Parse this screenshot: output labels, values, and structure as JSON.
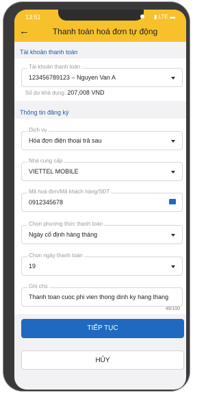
{
  "status": {
    "time": "13:51",
    "network": "LTE"
  },
  "header": {
    "title": "Thanh toán hoá đơn tự động",
    "back_icon": "back-arrow-icon"
  },
  "account": {
    "section_title": "Tài khoản thanh toán",
    "field_label": "Tài khoản thanh toán",
    "field_value": "123456789123 – Nguyen Van A",
    "balance_label": "Số dư khả dụng: ",
    "balance_value": "207,008 VND"
  },
  "registration": {
    "section_title": "Thông tin đăng ký",
    "fields": {
      "service": {
        "label": "Dịch vụ",
        "value": "Hóa đơn điện thoại trả sau"
      },
      "provider": {
        "label": "Nhà cung cấp",
        "value": "VIETTEL MOBILE"
      },
      "invoice": {
        "label": "Mã hoá đơn/Mã khách hàng/SĐT",
        "value": "0912345678"
      },
      "method": {
        "label": "Chọn phương thức thanh toán",
        "value": "Ngày cố định hàng tháng"
      },
      "payment_day": {
        "label": "Chọn ngày thanh toán",
        "value": "19"
      },
      "note": {
        "label": "Ghi chú",
        "value": "Thanh toan cuoc phi vien thong dinh ky hang thang",
        "counter": "49/100"
      }
    }
  },
  "actions": {
    "continue_label": "TIẾP TỤC",
    "cancel_label": "HỦY"
  },
  "colors": {
    "header": "#f7c12b",
    "accent": "#1f6ac0",
    "section_title": "#1f5aa8"
  }
}
